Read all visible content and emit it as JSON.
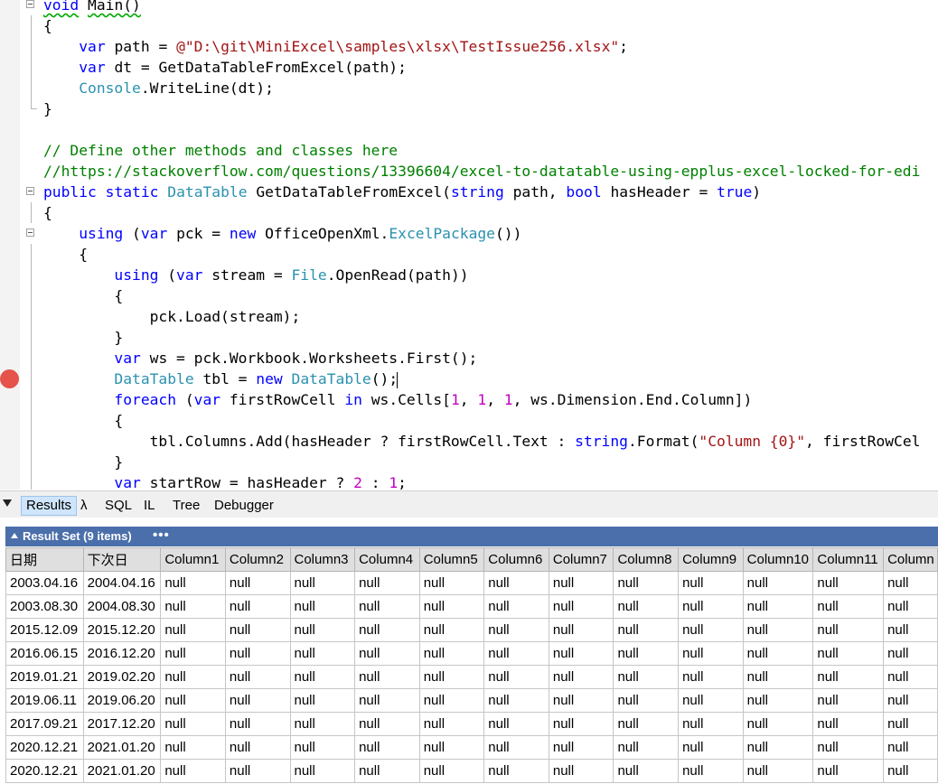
{
  "code": {
    "lines": [
      [
        {
          "t": "void",
          "c": "k",
          "sq": 1
        },
        {
          "t": " "
        },
        {
          "t": "Main()",
          "sq": 1
        }
      ],
      [
        {
          "t": "{"
        }
      ],
      [
        {
          "t": "    "
        },
        {
          "t": "var",
          "c": "k"
        },
        {
          "t": " path = "
        },
        {
          "t": "@\"D:\\git\\MiniExcel\\samples\\xlsx\\TestIssue256.xlsx\"",
          "c": "s"
        },
        {
          "t": ";"
        }
      ],
      [
        {
          "t": "    "
        },
        {
          "t": "var",
          "c": "k"
        },
        {
          "t": " dt = GetDataTableFromExcel(path);"
        }
      ],
      [
        {
          "t": "    "
        },
        {
          "t": "Console",
          "c": "t"
        },
        {
          "t": ".WriteLine(dt);"
        }
      ],
      [
        {
          "t": "}"
        }
      ],
      [],
      [
        {
          "t": "// Define other methods and classes here",
          "c": "c"
        }
      ],
      [
        {
          "t": "//https://stackoverflow.com/questions/13396604/excel-to-datatable-using-epplus-excel-locked-for-edi",
          "c": "c"
        }
      ],
      [
        {
          "t": "public",
          "c": "k"
        },
        {
          "t": " "
        },
        {
          "t": "static",
          "c": "k"
        },
        {
          "t": " "
        },
        {
          "t": "DataTable",
          "c": "t"
        },
        {
          "t": " GetDataTableFromExcel("
        },
        {
          "t": "string",
          "c": "k"
        },
        {
          "t": " path, "
        },
        {
          "t": "bool",
          "c": "k"
        },
        {
          "t": " hasHeader = "
        },
        {
          "t": "true",
          "c": "k"
        },
        {
          "t": ")"
        }
      ],
      [
        {
          "t": "{"
        }
      ],
      [
        {
          "t": "    "
        },
        {
          "t": "using",
          "c": "k"
        },
        {
          "t": " ("
        },
        {
          "t": "var",
          "c": "k"
        },
        {
          "t": " pck = "
        },
        {
          "t": "new",
          "c": "k"
        },
        {
          "t": " OfficeOpenXml."
        },
        {
          "t": "ExcelPackage",
          "c": "t"
        },
        {
          "t": "())"
        }
      ],
      [
        {
          "t": "    {"
        }
      ],
      [
        {
          "t": "        "
        },
        {
          "t": "using",
          "c": "k"
        },
        {
          "t": " ("
        },
        {
          "t": "var",
          "c": "k"
        },
        {
          "t": " stream = "
        },
        {
          "t": "File",
          "c": "t"
        },
        {
          "t": ".OpenRead(path))"
        }
      ],
      [
        {
          "t": "        {"
        }
      ],
      [
        {
          "t": "            pck.Load(stream);"
        }
      ],
      [
        {
          "t": "        }"
        }
      ],
      [
        {
          "t": "        "
        },
        {
          "t": "var",
          "c": "k"
        },
        {
          "t": " ws = pck.Workbook.Worksheets.First();"
        }
      ],
      [
        {
          "t": "        "
        },
        {
          "t": "DataTable",
          "c": "t"
        },
        {
          "t": " tbl = "
        },
        {
          "t": "new",
          "c": "k"
        },
        {
          "t": " "
        },
        {
          "t": "DataTable",
          "c": "t"
        },
        {
          "t": "();"
        },
        {
          "caret": 1
        }
      ],
      [
        {
          "t": "        "
        },
        {
          "t": "foreach",
          "c": "k"
        },
        {
          "t": " ("
        },
        {
          "t": "var",
          "c": "k"
        },
        {
          "t": " firstRowCell "
        },
        {
          "t": "in",
          "c": "k"
        },
        {
          "t": " ws.Cells["
        },
        {
          "t": "1",
          "c": "n"
        },
        {
          "t": ", "
        },
        {
          "t": "1",
          "c": "n"
        },
        {
          "t": ", "
        },
        {
          "t": "1",
          "c": "n"
        },
        {
          "t": ", ws.Dimension.End.Column])"
        }
      ],
      [
        {
          "t": "        {"
        }
      ],
      [
        {
          "t": "            tbl.Columns.Add(hasHeader ? firstRowCell.Text : "
        },
        {
          "t": "string",
          "c": "k"
        },
        {
          "t": ".Format("
        },
        {
          "t": "\"Column {0}\"",
          "c": "s"
        },
        {
          "t": ", firstRowCel"
        }
      ],
      [
        {
          "t": "        }"
        }
      ],
      [
        {
          "t": "        "
        },
        {
          "t": "var",
          "c": "k"
        },
        {
          "t": " startRow = hasHeader ? "
        },
        {
          "t": "2",
          "c": "n"
        },
        {
          "t": " : "
        },
        {
          "t": "1",
          "c": "n"
        },
        {
          "t": ";"
        }
      ]
    ]
  },
  "tabs": [
    {
      "label": "Results",
      "active": true
    },
    {
      "label": "λ"
    },
    {
      "label": "SQL"
    },
    {
      "label": "IL"
    },
    {
      "label": "Tree"
    },
    {
      "label": "Debugger"
    }
  ],
  "result_set": {
    "title": "Result Set (9 items)",
    "more": "•••",
    "columns": [
      "日期",
      "下次日",
      "Column1",
      "Column2",
      "Column3",
      "Column4",
      "Column5",
      "Column6",
      "Column7",
      "Column8",
      "Column9",
      "Column10",
      "Column11",
      "Column"
    ],
    "rows": [
      [
        "2003.04.16",
        "2004.04.16",
        "null",
        "null",
        "null",
        "null",
        "null",
        "null",
        "null",
        "null",
        "null",
        "null",
        "null",
        "null"
      ],
      [
        "2003.08.30",
        "2004.08.30",
        "null",
        "null",
        "null",
        "null",
        "null",
        "null",
        "null",
        "null",
        "null",
        "null",
        "null",
        "null"
      ],
      [
        "2015.12.09",
        "2015.12.20",
        "null",
        "null",
        "null",
        "null",
        "null",
        "null",
        "null",
        "null",
        "null",
        "null",
        "null",
        "null"
      ],
      [
        "2016.06.15",
        "2016.12.20",
        "null",
        "null",
        "null",
        "null",
        "null",
        "null",
        "null",
        "null",
        "null",
        "null",
        "null",
        "null"
      ],
      [
        "2019.01.21",
        "2019.02.20",
        "null",
        "null",
        "null",
        "null",
        "null",
        "null",
        "null",
        "null",
        "null",
        "null",
        "null",
        "null"
      ],
      [
        "2019.06.11",
        "2019.06.20",
        "null",
        "null",
        "null",
        "null",
        "null",
        "null",
        "null",
        "null",
        "null",
        "null",
        "null",
        "null"
      ],
      [
        "2017.09.21",
        "2017.12.20",
        "null",
        "null",
        "null",
        "null",
        "null",
        "null",
        "null",
        "null",
        "null",
        "null",
        "null",
        "null"
      ],
      [
        "2020.12.21",
        "2021.01.20",
        "null",
        "null",
        "null",
        "null",
        "null",
        "null",
        "null",
        "null",
        "null",
        "null",
        "null",
        "null"
      ],
      [
        "2020.12.21",
        "2021.01.20",
        "null",
        "null",
        "null",
        "null",
        "null",
        "null",
        "null",
        "null",
        "null",
        "null",
        "null",
        "null"
      ]
    ]
  },
  "colors": {
    "keyword": "#0000ff",
    "type": "#2b91af",
    "string": "#a31515",
    "comment": "#008000",
    "number": "#c000c0",
    "result_header": "#4b6faa",
    "breakpoint": "#e5534b"
  }
}
